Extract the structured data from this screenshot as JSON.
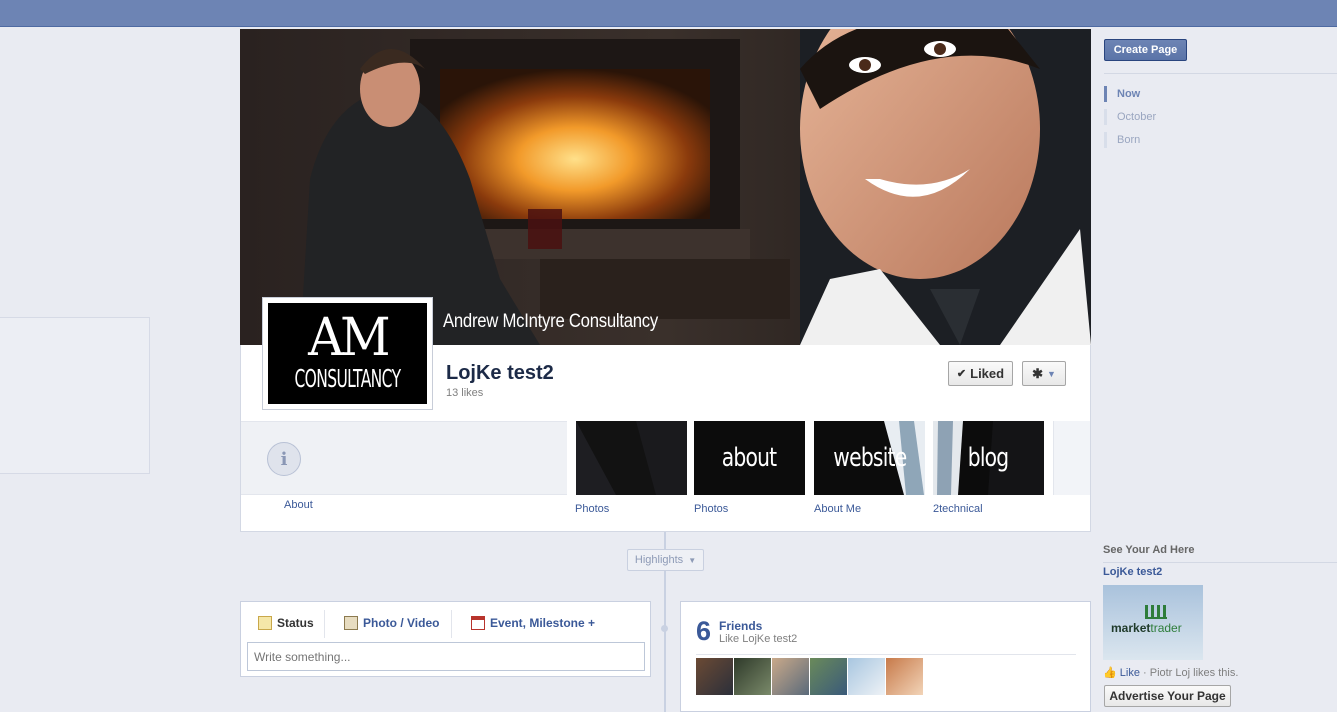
{
  "header": {
    "create_page": "Create Page"
  },
  "timeline_nav": {
    "items": [
      {
        "label": "Now"
      },
      {
        "label": "October"
      },
      {
        "label": "Born"
      }
    ]
  },
  "cover": {
    "logo_top": "AM",
    "logo_bottom": "CONSULTANCY",
    "tagline": "Andrew McIntyre Consultancy"
  },
  "profile": {
    "name": "LojKe test2",
    "likes": "13 likes",
    "liked_label": "Liked"
  },
  "apps": {
    "about_label": "About",
    "tiles": [
      {
        "label": "Photos",
        "thumb_text": ""
      },
      {
        "label": "Photos",
        "thumb_text": "about"
      },
      {
        "label": "About Me",
        "thumb_text": "website"
      },
      {
        "label": "2technical",
        "thumb_text": "blog"
      }
    ]
  },
  "highlights": {
    "label": "Highlights"
  },
  "composer": {
    "tabs": [
      {
        "label": "Status"
      },
      {
        "label": "Photo / Video"
      },
      {
        "label": "Event, Milestone +"
      }
    ],
    "placeholder": "Write something..."
  },
  "friends_box": {
    "count": "6",
    "title": "Friends",
    "subtitle": "Like LojKe test2"
  },
  "ad": {
    "heading": "See Your Ad Here",
    "title": "LojKe test2",
    "image_text_a": "market",
    "image_text_b": "trader",
    "like_label": "Like",
    "like_text": " · Piotr Loj likes this.",
    "advertise_label": "Advertise Your Page"
  },
  "colors": {
    "brand": "#3b5998",
    "topbar": "#6d84b4",
    "background": "#e9ebf2"
  }
}
